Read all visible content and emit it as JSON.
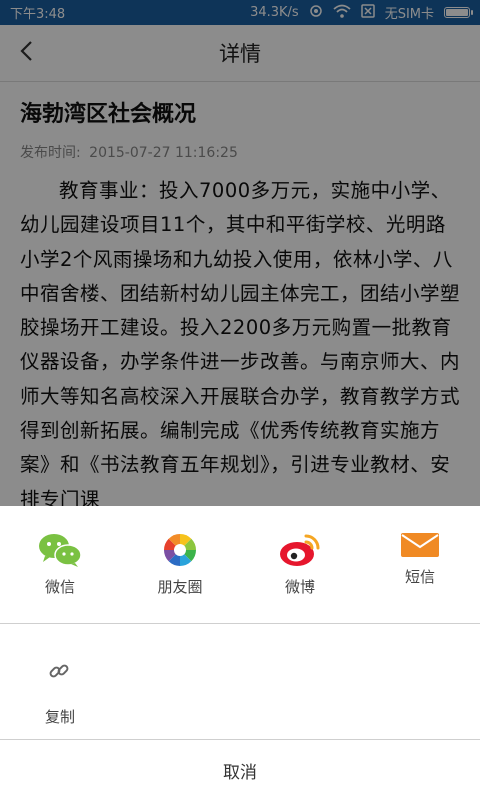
{
  "status_bar": {
    "time": "下午3:48",
    "speed": "34.3K/s",
    "sim": "无SIM卡"
  },
  "nav": {
    "title": "详情"
  },
  "article": {
    "title": "海勃湾区社会概况",
    "publish_label": "发布时间:",
    "publish_time": "2015-07-27 11:16:25",
    "body": "教育事业：投入7000多万元，实施中小学、幼儿园建设项目11个，其中和平街学校、光明路小学2个风雨操场和九幼投入使用，依林小学、八中宿舍楼、团结新村幼儿园主体完工，团结小学塑胶操场开工建设。投入2200多万元购置一批教育仪器设备，办学条件进一步改善。与南京师大、内师大等知名高校深入开展联合办学，教育教学方式得到创新拓展。编制完成《优秀传统教育实施方案》和《书法教育五年规划》，引进专业教材、安排专门课"
  },
  "share": {
    "items": [
      {
        "label": "微信",
        "icon": "wechat-icon"
      },
      {
        "label": "朋友圈",
        "icon": "moments-icon"
      },
      {
        "label": "微博",
        "icon": "weibo-icon"
      },
      {
        "label": "短信",
        "icon": "sms-icon"
      }
    ],
    "copy_label": "复制",
    "cancel_label": "取消"
  },
  "colors": {
    "status_bar": "#1a5fa0",
    "wechat": "#7ac142",
    "weibo": "#e6162d",
    "sms": "#f08a24"
  }
}
